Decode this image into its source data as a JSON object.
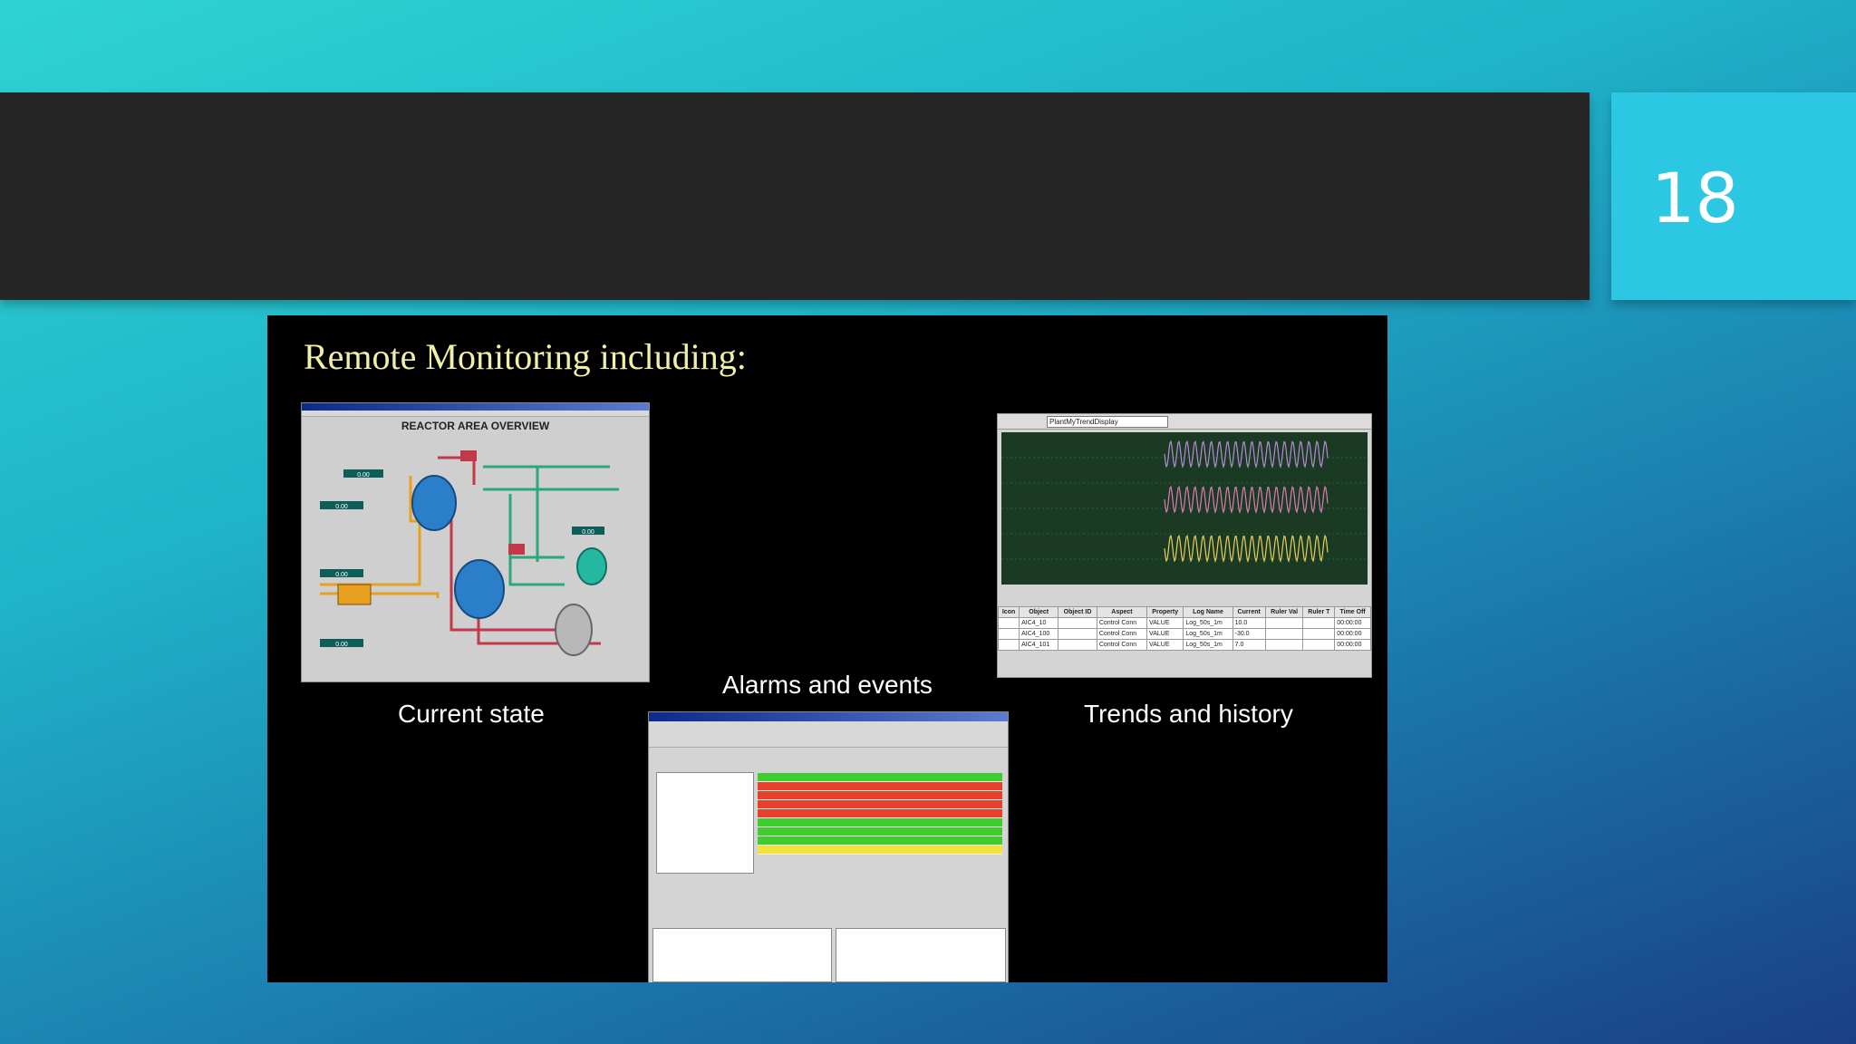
{
  "slide_number": "18",
  "heading": "Remote Monitoring including:",
  "captions": {
    "current_state": "Current state",
    "alarms_events": "Alarms and events",
    "trends_history": "Trends and history"
  },
  "reactor_panel": {
    "title": "REACTOR AREA OVERVIEW",
    "readouts": [
      "0.00",
      "0.00",
      "0.00",
      "0.00",
      "0.00"
    ]
  },
  "trends_panel": {
    "display_name": "PlantMyTrendDisplay",
    "columns": [
      "Icon",
      "Object",
      "Object ID",
      "Aspect",
      "Property",
      "Log Name",
      "Current",
      "Ruler Val",
      "Ruler T",
      "Time Off"
    ],
    "rows": [
      [
        "",
        "AIC4_10",
        "",
        "Control Conn",
        "VALUE",
        "Log_50s_1m",
        "10.0",
        "",
        "",
        "00:00:00"
      ],
      [
        "",
        "AIC4_100",
        "",
        "Control Conn",
        "VALUE",
        "Log_50s_1m",
        "-30.0",
        "",
        "",
        "00:00:00"
      ],
      [
        "",
        "AIC4_101",
        "",
        "Control Conn",
        "VALUE",
        "Log_50s_1m",
        "7.0",
        "",
        "",
        "00:00:00"
      ]
    ]
  },
  "colors": {
    "alarm_green": "#3fcc2f",
    "alarm_red": "#e8402a",
    "alarm_yellow": "#f2e23a",
    "trend_purple": "#b88ad8",
    "trend_pink": "#e07ab8",
    "trend_yellow": "#e8cf5a"
  },
  "alarm_rows": [
    "green",
    "red",
    "red",
    "red",
    "red",
    "green",
    "green",
    "green",
    "yellow"
  ]
}
